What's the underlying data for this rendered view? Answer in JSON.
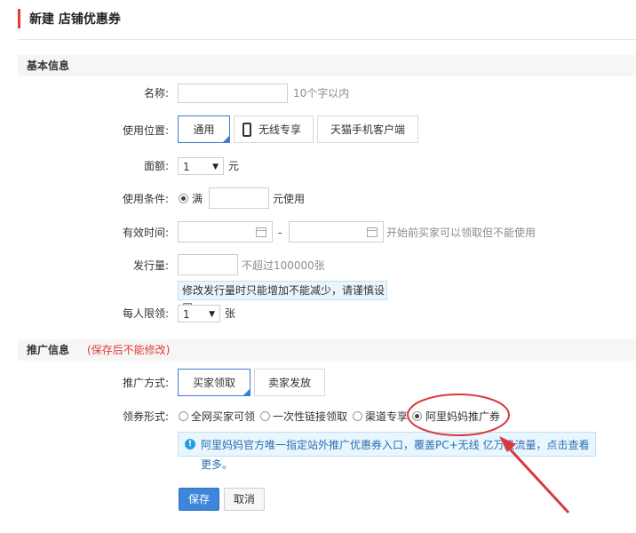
{
  "page_title": "新建 店铺优惠券",
  "basic": {
    "section_title": "基本信息",
    "name": {
      "label": "名称:",
      "value": "",
      "hint": "10个字以内"
    },
    "position": {
      "label": "使用位置:",
      "options": [
        {
          "label": "通用",
          "selected": true
        },
        {
          "label": "无线专享",
          "selected": false
        },
        {
          "label": "天猫手机客户端",
          "selected": false
        }
      ]
    },
    "denomination": {
      "label": "面额:",
      "value": "1",
      "unit": "元"
    },
    "condition": {
      "label": "使用条件:",
      "radio_label": "满",
      "value": "",
      "suffix": "元使用"
    },
    "validity": {
      "label": "有效时间:",
      "start": "",
      "separator": "-",
      "end": "",
      "hint": "开始前买家可以领取但不能使用"
    },
    "quantity": {
      "label": "发行量:",
      "value": "",
      "hint": "不超过100000张",
      "tip": "修改发行量时只能增加不能减少，请谨慎设置"
    },
    "limit": {
      "label": "每人限领:",
      "value": "1",
      "unit": "张"
    }
  },
  "promo": {
    "section_title": "推广信息",
    "section_note": "(保存后不能修改)",
    "method": {
      "label": "推广方式:",
      "options": [
        {
          "label": "买家领取",
          "selected": true
        },
        {
          "label": "卖家发放",
          "selected": false
        }
      ]
    },
    "form": {
      "label": "领券形式:",
      "options": [
        {
          "label": "全网买家可领",
          "selected": false
        },
        {
          "label": "一次性链接领取",
          "selected": false
        },
        {
          "label": "渠道专享",
          "selected": false
        },
        {
          "label": "阿里妈妈推广券",
          "selected": true
        }
      ]
    },
    "info": {
      "icon": "info-icon",
      "text": "阿里妈妈官方唯一指定站外推广优惠券入口，覆盖PC+无线 亿万级流量，点击查看更多。"
    }
  },
  "actions": {
    "save_label": "保存",
    "cancel_label": "取消"
  },
  "colors": {
    "accent": "#3d7ad6",
    "title_bar": "#e33a3a",
    "note": "#e03b3b",
    "highlight_circle": "#d9383f",
    "arrow": "#d9383f"
  }
}
